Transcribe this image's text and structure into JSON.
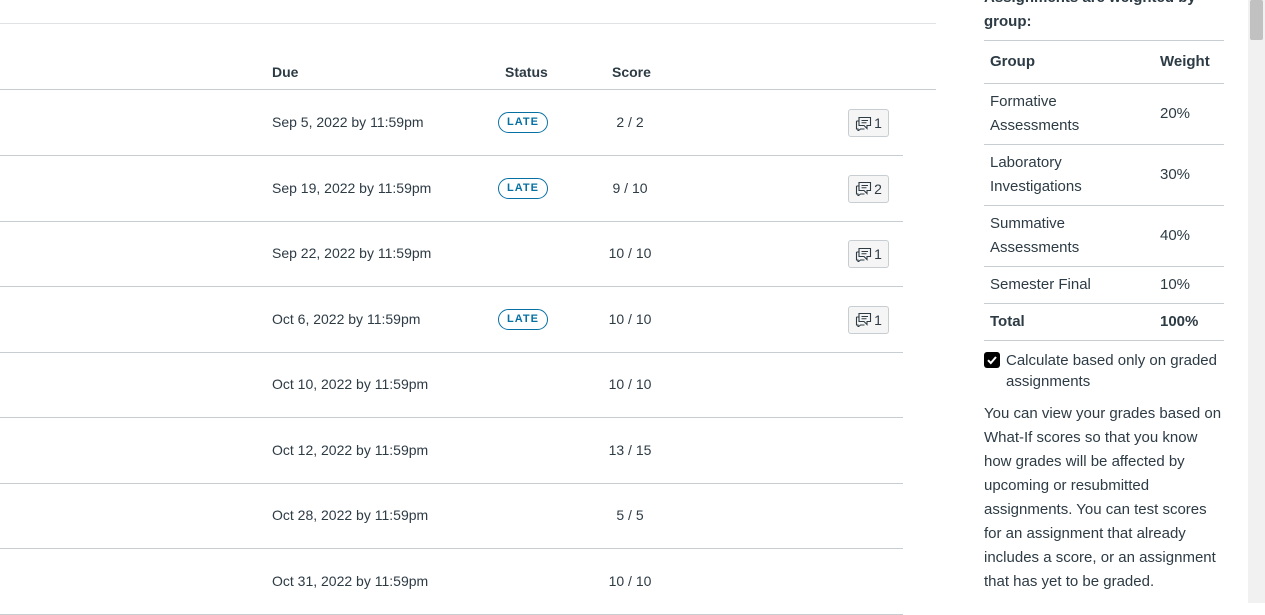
{
  "grades": {
    "headers": {
      "due": "Due",
      "status": "Status",
      "score": "Score"
    },
    "rows": [
      {
        "due": "Sep 5, 2022 by 11:59pm",
        "status": "LATE",
        "score": "2 / 2",
        "comments": "1"
      },
      {
        "due": "Sep 19, 2022 by 11:59pm",
        "status": "LATE",
        "score": "9 / 10",
        "comments": "2"
      },
      {
        "due": "Sep 22, 2022 by 11:59pm",
        "status": "",
        "score": "10 / 10",
        "comments": "1"
      },
      {
        "due": "Oct 6, 2022 by 11:59pm",
        "status": "LATE",
        "score": "10 / 10",
        "comments": "1"
      },
      {
        "due": "Oct 10, 2022 by 11:59pm",
        "status": "",
        "score": "10 / 10",
        "comments": ""
      },
      {
        "due": "Oct 12, 2022 by 11:59pm",
        "status": "",
        "score": "13 / 15",
        "comments": ""
      },
      {
        "due": "Oct 28, 2022 by 11:59pm",
        "status": "",
        "score": "5 / 5",
        "comments": ""
      },
      {
        "due": "Oct 31, 2022 by 11:59pm",
        "status": "",
        "score": "10 / 10",
        "comments": ""
      }
    ]
  },
  "sidebar": {
    "intro": "Assignments are weighted by group:",
    "table": {
      "header_group": "Group",
      "header_weight": "Weight",
      "rows": [
        {
          "group": "Formative Assessments",
          "weight": "20%"
        },
        {
          "group": "Laboratory Investigations",
          "weight": "30%"
        },
        {
          "group": "Summative Assessments",
          "weight": "40%"
        },
        {
          "group": "Semester Final",
          "weight": "10%"
        }
      ],
      "total_label": "Total",
      "total_weight": "100%"
    },
    "calculate_label": "Calculate based only on graded assignments",
    "calculate_checked": true,
    "whatif_text": "You can view your grades based on What-If scores so that you know how grades will be affected by upcoming or resubmitted assignments. You can test scores for an assignment that already includes a score, or an assignment that has yet to be graded."
  },
  "colors": {
    "accent": "#0770a3",
    "text": "#2d3b45",
    "border": "#c7cdd1"
  },
  "icons": {
    "comment": "comment-icon",
    "check": "check-icon"
  }
}
